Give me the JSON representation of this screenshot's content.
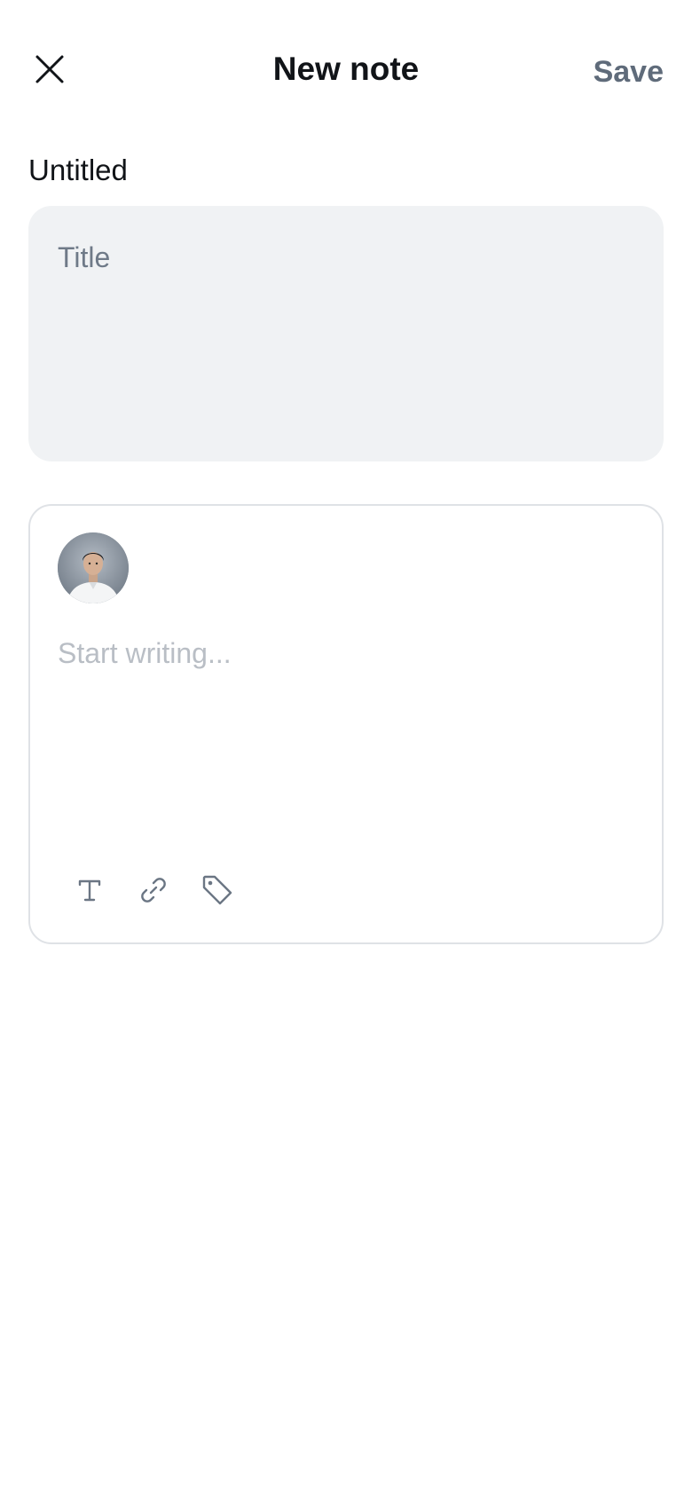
{
  "header": {
    "title": "New note",
    "save_label": "Save",
    "close_icon": "close-icon"
  },
  "note": {
    "name": "Untitled",
    "title_placeholder": "Title",
    "title_value": "",
    "body_placeholder": "Start writing...",
    "body_value": ""
  },
  "toolbar": {
    "icons": [
      "text-format-icon",
      "link-icon",
      "tag-icon"
    ]
  },
  "colors": {
    "accent_muted": "#5f6b7a",
    "field_background": "#f0f2f4",
    "card_border": "#dfe2e6",
    "icon_color": "#6b7684"
  }
}
